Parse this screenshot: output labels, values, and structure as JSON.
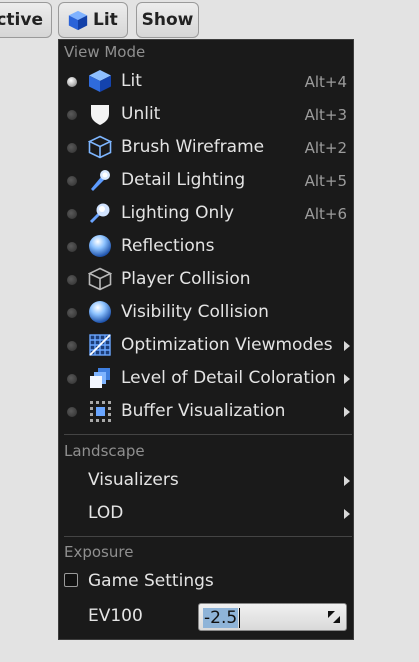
{
  "toolbar": {
    "perspective_label": "ective",
    "lit_label": "Lit",
    "show_label": "Show"
  },
  "menu": {
    "view_mode": {
      "title": "View Mode",
      "items": [
        {
          "label": "Lit",
          "shortcut": "Alt+4",
          "icon": "lit-cube-icon",
          "selected": true
        },
        {
          "label": "Unlit",
          "shortcut": "Alt+3",
          "icon": "shield-icon",
          "selected": false
        },
        {
          "label": "Brush Wireframe",
          "shortcut": "Alt+2",
          "icon": "wireframe-cube-icon",
          "selected": false
        },
        {
          "label": "Detail Lighting",
          "shortcut": "Alt+5",
          "icon": "flashlight-icon",
          "selected": false
        },
        {
          "label": "Lighting Only",
          "shortcut": "Alt+6",
          "icon": "lightbulb-icon",
          "selected": false
        },
        {
          "label": "Reflections",
          "shortcut": "",
          "icon": "sphere-icon",
          "selected": false
        },
        {
          "label": "Player Collision",
          "shortcut": "",
          "icon": "collision-cube-icon",
          "selected": false
        },
        {
          "label": "Visibility Collision",
          "shortcut": "",
          "icon": "sphere-icon",
          "selected": false
        },
        {
          "label": "Optimization Viewmodes",
          "shortcut": "",
          "icon": "grid-icon",
          "selected": false,
          "submenu": true
        },
        {
          "label": "Level of Detail Coloration",
          "shortcut": "",
          "icon": "stacked-cubes-icon",
          "selected": false,
          "submenu": true
        },
        {
          "label": "Buffer Visualization",
          "shortcut": "",
          "icon": "dotted-grid-icon",
          "selected": false,
          "submenu": true
        }
      ]
    },
    "landscape": {
      "title": "Landscape",
      "items": [
        {
          "label": "Visualizers",
          "submenu": true
        },
        {
          "label": "LOD",
          "submenu": true
        }
      ]
    },
    "exposure": {
      "title": "Exposure",
      "game_settings_label": "Game Settings",
      "game_settings_checked": false,
      "ev100_label": "EV100",
      "ev100_value": "-2.5"
    }
  }
}
